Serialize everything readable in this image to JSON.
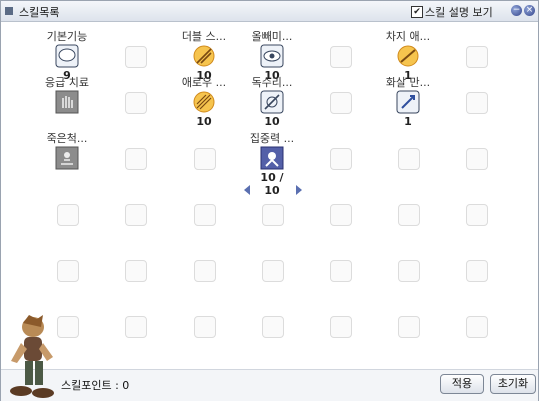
{
  "window": {
    "title": "스킬목록",
    "show_desc_label": "스킬 설명 보기",
    "show_desc_checked": true
  },
  "skills": [
    {
      "name": "기본기능",
      "level": "9",
      "icon": "balloon-icon"
    },
    {
      "name": "더블 스...",
      "level": "10",
      "icon": "double-strafe-icon"
    },
    {
      "name": "올빼미...",
      "level": "10",
      "icon": "owl-eye-icon"
    },
    {
      "name": "차지 애...",
      "level": "1",
      "icon": "charge-arrow-icon"
    },
    {
      "name": "응급 치료",
      "level": "",
      "icon": "first-aid-icon"
    },
    {
      "name": "애로우 ...",
      "level": "10",
      "icon": "arrow-shower-icon"
    },
    {
      "name": "독수리...",
      "level": "10",
      "icon": "vultures-eye-icon"
    },
    {
      "name": "화살 만...",
      "level": "1",
      "icon": "arrow-crafting-icon"
    },
    {
      "name": "죽은척...",
      "level": "",
      "icon": "play-dead-icon"
    },
    {
      "name": "집중력 ...",
      "level": "10 / 10",
      "icon": "concentration-icon"
    }
  ],
  "footer": {
    "points_label": "스킬포인트 : 0",
    "apply_label": "적용",
    "reset_label": "초기화"
  }
}
